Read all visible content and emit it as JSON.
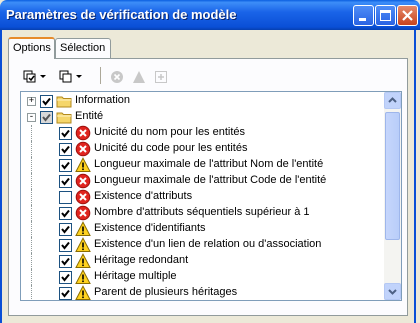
{
  "window": {
    "title": "Paramètres de vérification de modèle"
  },
  "tabs": [
    {
      "label": "Options",
      "active": true
    },
    {
      "label": "Sélection",
      "active": false
    }
  ],
  "tree": {
    "rows": [
      {
        "label": "Information",
        "kind": "folder",
        "expand": "+",
        "checked": true,
        "level": 0
      },
      {
        "label": "Entité",
        "kind": "folder",
        "expand": "-",
        "checked": true,
        "grey": true,
        "level": 0
      },
      {
        "label": "Unicité du nom pour les entités",
        "kind": "error",
        "checked": true,
        "level": 1
      },
      {
        "label": "Unicité du code pour les entités",
        "kind": "error",
        "checked": true,
        "level": 1
      },
      {
        "label": "Longueur maximale de l'attribut Nom de l'entité",
        "kind": "warning",
        "checked": true,
        "level": 1
      },
      {
        "label": "Longueur maximale de l'attribut Code de l'entité",
        "kind": "error",
        "checked": true,
        "level": 1
      },
      {
        "label": "Existence d'attributs",
        "kind": "error",
        "checked": false,
        "level": 1
      },
      {
        "label": "Nombre d'attributs séquentiels supérieur à 1",
        "kind": "error",
        "checked": true,
        "level": 1
      },
      {
        "label": "Existence d'identifiants",
        "kind": "warning",
        "checked": true,
        "level": 1
      },
      {
        "label": "Existence d'un lien de relation ou d'association",
        "kind": "warning",
        "checked": true,
        "level": 1
      },
      {
        "label": "Héritage redondant",
        "kind": "warning",
        "checked": true,
        "level": 1
      },
      {
        "label": "Héritage multiple",
        "kind": "warning",
        "checked": true,
        "level": 1
      },
      {
        "label": "Parent de plusieurs héritages",
        "kind": "warning",
        "checked": true,
        "level": 1
      }
    ]
  }
}
